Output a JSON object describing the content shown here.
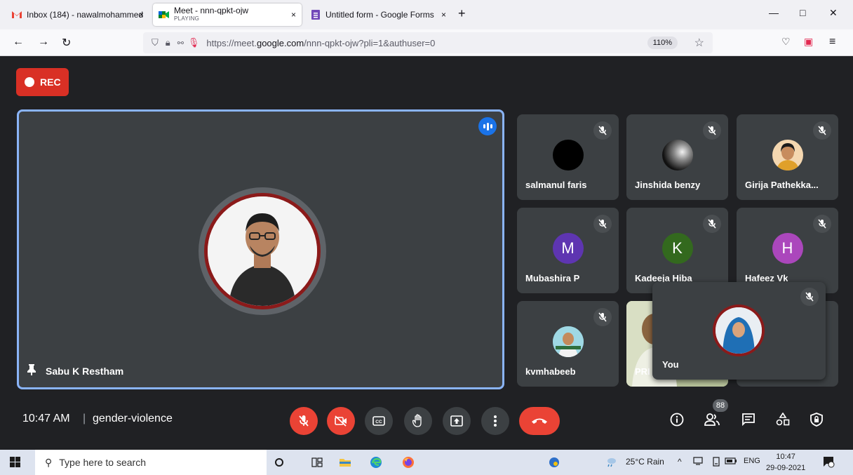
{
  "browser": {
    "tabs": [
      {
        "title": "Inbox (184) - nawalmohammed",
        "close": "×"
      },
      {
        "title": "Meet - nnn-qpkt-ojw",
        "subtitle": "PLAYING",
        "close": "×"
      },
      {
        "title": "Untitled form - Google Forms",
        "close": "×"
      }
    ],
    "new_tab": "+",
    "window_controls": {
      "minimize": "—",
      "maximize": "□",
      "close": "✕"
    },
    "url_prefix": "https://meet.",
    "url_host": "google.com",
    "url_suffix": "/nnn-qpkt-ojw?pli=1&authuser=0",
    "zoom": "110%"
  },
  "meet": {
    "rec_label": "REC",
    "main_speaker": {
      "name": "Sabu K Restham"
    },
    "participants": [
      {
        "name": "salmanul faris",
        "avatar_type": "photo-dark",
        "color": "#000000"
      },
      {
        "name": "Jinshida benzy",
        "avatar_type": "photo-gray",
        "color": "#202124"
      },
      {
        "name": "Girija Pathekka...",
        "avatar_type": "photo",
        "color": "#f4d7b0"
      },
      {
        "name": "Mubashira P",
        "avatar_type": "letter",
        "letter": "M",
        "color": "#5e35b1"
      },
      {
        "name": "Kadeeja Hiba",
        "avatar_type": "letter",
        "letter": "K",
        "color": "#33691e"
      },
      {
        "name": "Hafeez Vk",
        "avatar_type": "letter",
        "letter": "H",
        "color": "#ab47bc"
      },
      {
        "name": "kvmhabeeb",
        "avatar_type": "photo",
        "color": "#7ecbd8"
      },
      {
        "name": "PRI",
        "avatar_type": "video",
        "color": "#a8b48a"
      }
    ],
    "self_tile": {
      "name": "You"
    },
    "meeting_time": "10:47 AM",
    "separator": "|",
    "meeting_name": "gender-violence",
    "participant_count": "88"
  },
  "taskbar": {
    "search_placeholder": "Type here to search",
    "weather": "25°C  Rain",
    "language": "ENG",
    "time": "10:47",
    "date": "29-09-2021"
  },
  "colors": {
    "meet_bg": "#202124",
    "tile_bg": "#3c4043",
    "accent_red": "#ea4335",
    "speaking_border": "#8ab4f8"
  }
}
